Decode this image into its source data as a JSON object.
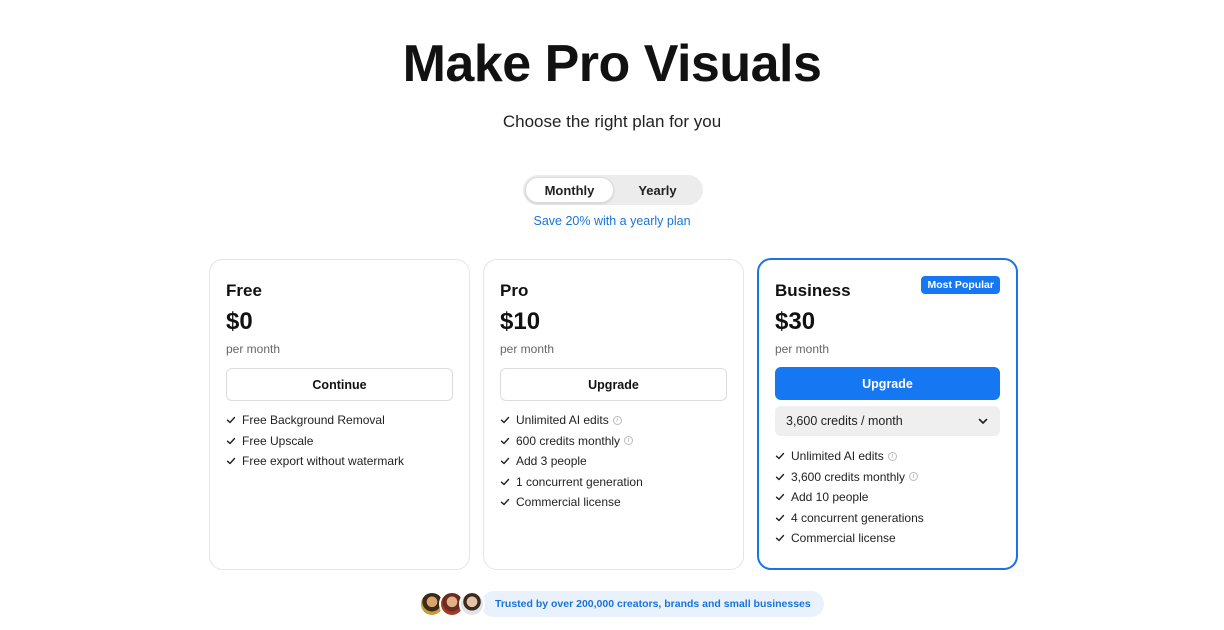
{
  "hero": {
    "title": "Make Pro Visuals",
    "subtitle": "Choose the right plan for you"
  },
  "billing_toggle": {
    "options": [
      "Monthly",
      "Yearly"
    ],
    "selected": "Monthly",
    "note": "Save 20% with a yearly plan"
  },
  "plans": [
    {
      "name": "Free",
      "price": "$0",
      "period": "per month",
      "button": "Continue",
      "features": [
        {
          "text": "Free Background Removal",
          "info": false
        },
        {
          "text": "Free Upscale",
          "info": false
        },
        {
          "text": "Free export without watermark",
          "info": false
        }
      ]
    },
    {
      "name": "Pro",
      "price": "$10",
      "period": "per month",
      "button": "Upgrade",
      "features": [
        {
          "text": "Unlimited AI edits",
          "info": true
        },
        {
          "text": "600 credits monthly",
          "info": true
        },
        {
          "text": "Add 3 people",
          "info": false
        },
        {
          "text": "1 concurrent generation",
          "info": false
        },
        {
          "text": "Commercial license",
          "info": false
        }
      ]
    },
    {
      "name": "Business",
      "badge": "Most Popular",
      "price": "$30",
      "period": "per month",
      "button": "Upgrade",
      "credits_select": "3,600 credits / month",
      "features": [
        {
          "text": "Unlimited AI edits",
          "info": true
        },
        {
          "text": "3,600 credits monthly",
          "info": true
        },
        {
          "text": "Add 10 people",
          "info": false
        },
        {
          "text": "4 concurrent generations",
          "info": false
        },
        {
          "text": "Commercial license",
          "info": false
        }
      ]
    }
  ],
  "trust": {
    "text": "Trusted by over 200,000 creators, brands and small businesses"
  },
  "colors": {
    "accent": "#1677f2",
    "accent_text": "#1a73d9",
    "trust_bg": "#e8f1fc"
  }
}
